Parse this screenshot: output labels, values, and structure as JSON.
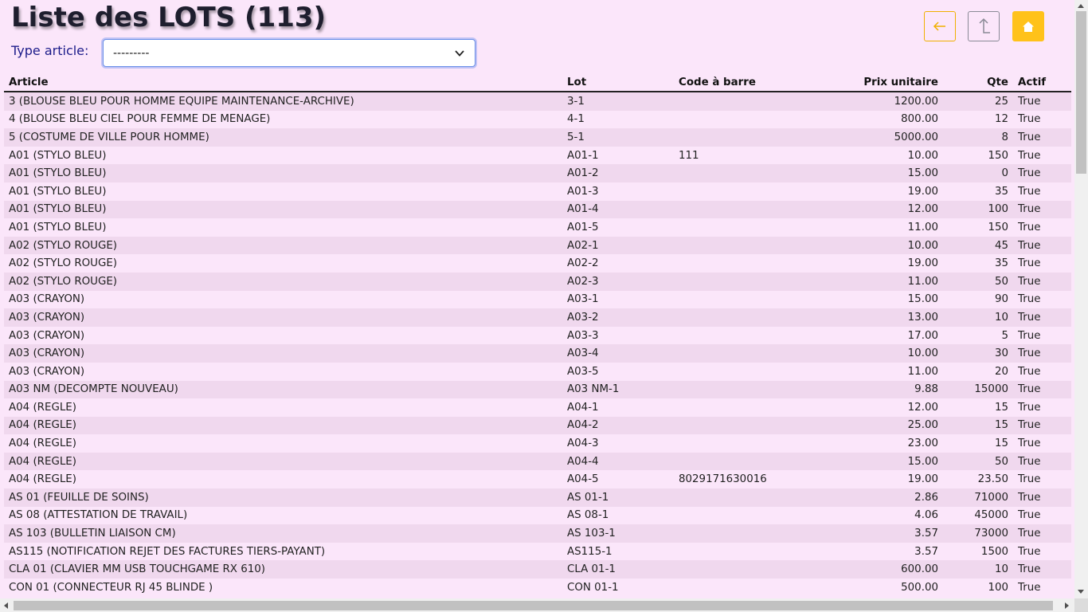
{
  "page": {
    "title": "Liste des LOTS (113)",
    "filter_label": "Type article:",
    "filter_value": "---------"
  },
  "nav": {
    "back_icon": "arrow-left-icon",
    "up_icon": "level-up-icon",
    "home_icon": "home-icon"
  },
  "colors": {
    "background": "#fbe6fa",
    "row_stripe": "#f0d8ee",
    "nav_accent": "#ffc21a",
    "title": "#1e1e2e",
    "label": "#1c1c8a"
  },
  "table": {
    "headers": [
      "Article",
      "Lot",
      "Code à barre",
      "Prix unitaire",
      "Qte",
      "Actif"
    ],
    "rows": [
      [
        "3 (BLOUSE BLEU POUR HOMME EQUIPE MAINTENANCE-ARCHIVE)",
        "3-1",
        "",
        "1200.00",
        "25",
        "True"
      ],
      [
        "4 (BLOUSE BLEU CIEL POUR FEMME DE MENAGE)",
        "4-1",
        "",
        "800.00",
        "12",
        "True"
      ],
      [
        "5 (COSTUME DE VILLE POUR HOMME)",
        "5-1",
        "",
        "5000.00",
        "8",
        "True"
      ],
      [
        "A01 (STYLO BLEU)",
        "A01-1",
        "111",
        "10.00",
        "150",
        "True"
      ],
      [
        "A01 (STYLO BLEU)",
        "A01-2",
        "",
        "15.00",
        "0",
        "True"
      ],
      [
        "A01 (STYLO BLEU)",
        "A01-3",
        "",
        "19.00",
        "35",
        "True"
      ],
      [
        "A01 (STYLO BLEU)",
        "A01-4",
        "",
        "12.00",
        "100",
        "True"
      ],
      [
        "A01 (STYLO BLEU)",
        "A01-5",
        "",
        "11.00",
        "150",
        "True"
      ],
      [
        "A02 (STYLO ROUGE)",
        "A02-1",
        "",
        "10.00",
        "45",
        "True"
      ],
      [
        "A02 (STYLO ROUGE)",
        "A02-2",
        "",
        "19.00",
        "35",
        "True"
      ],
      [
        "A02 (STYLO ROUGE)",
        "A02-3",
        "",
        "11.00",
        "50",
        "True"
      ],
      [
        "A03 (CRAYON)",
        "A03-1",
        "",
        "15.00",
        "90",
        "True"
      ],
      [
        "A03 (CRAYON)",
        "A03-2",
        "",
        "13.00",
        "10",
        "True"
      ],
      [
        "A03 (CRAYON)",
        "A03-3",
        "",
        "17.00",
        "5",
        "True"
      ],
      [
        "A03 (CRAYON)",
        "A03-4",
        "",
        "10.00",
        "30",
        "True"
      ],
      [
        "A03 (CRAYON)",
        "A03-5",
        "",
        "11.00",
        "20",
        "True"
      ],
      [
        "A03 NM (DECOMPTE NOUVEAU)",
        "A03 NM-1",
        "",
        "9.88",
        "15000",
        "True"
      ],
      [
        "A04 (REGLE)",
        "A04-1",
        "",
        "12.00",
        "15",
        "True"
      ],
      [
        "A04 (REGLE)",
        "A04-2",
        "",
        "25.00",
        "15",
        "True"
      ],
      [
        "A04 (REGLE)",
        "A04-3",
        "",
        "23.00",
        "15",
        "True"
      ],
      [
        "A04 (REGLE)",
        "A04-4",
        "",
        "15.00",
        "50",
        "True"
      ],
      [
        "A04 (REGLE)",
        "A04-5",
        "8029171630016",
        "19.00",
        "23.50",
        "True"
      ],
      [
        "AS 01 (FEUILLE DE SOINS)",
        "AS 01-1",
        "",
        "2.86",
        "71000",
        "True"
      ],
      [
        "AS 08 (ATTESTATION DE TRAVAIL)",
        "AS 08-1",
        "",
        "4.06",
        "45000",
        "True"
      ],
      [
        "AS 103 (BULLETIN LIAISON CM)",
        "AS 103-1",
        "",
        "3.57",
        "73000",
        "True"
      ],
      [
        "AS115 (NOTIFICATION REJET DES FACTURES TIERS-PAYANT)",
        "AS115-1",
        "",
        "3.57",
        "1500",
        "True"
      ],
      [
        "CLA 01 (CLAVIER MM USB TOUCHGAME RX 610)",
        "CLA 01-1",
        "",
        "600.00",
        "10",
        "True"
      ],
      [
        "CON 01 (CONNECTEUR RJ 45 BLINDE )",
        "CON 01-1",
        "",
        "500.00",
        "100",
        "True"
      ]
    ]
  }
}
